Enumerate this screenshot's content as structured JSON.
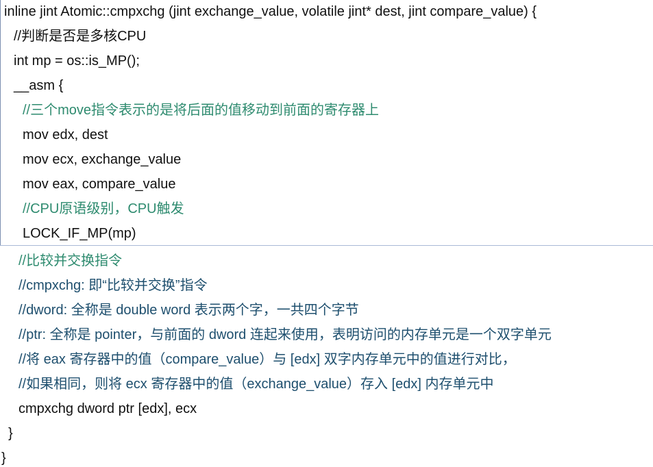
{
  "code_top": {
    "l1": "inline jint Atomic::cmpxchg (jint exchange_value, volatile jint* dest, jint compare_value) {",
    "l2": "//判断是否是多核CPU",
    "l3": "int mp = os::is_MP();",
    "l4": "__asm {",
    "l5": "//三个move指令表示的是将后面的值移动到前面的寄存器上",
    "l6": "mov edx, dest",
    "l7": "mov ecx, exchange_value",
    "l8": "mov eax, compare_value",
    "l9": "//CPU原语级别，CPU触发",
    "l10": "LOCK_IF_MP(mp)"
  },
  "code_bottom": {
    "l1": "//比较并交换指令",
    "l2": "//cmpxchg: 即“比较并交换”指令",
    "l3": "//dword: 全称是 double word 表示两个字，一共四个字节",
    "l4": "//ptr: 全称是 pointer，与前面的 dword 连起来使用，表明访问的内存单元是一个双字单元",
    "l5": "//将 eax 寄存器中的值（compare_value）与 [edx] 双字内存单元中的值进行对比，",
    "l6": "//如果相同，则将 ecx 寄存器中的值（exchange_value）存入 [edx] 内存单元中",
    "l7": "cmpxchg dword ptr [edx], ecx",
    "l8": "}",
    "l9": "}"
  }
}
